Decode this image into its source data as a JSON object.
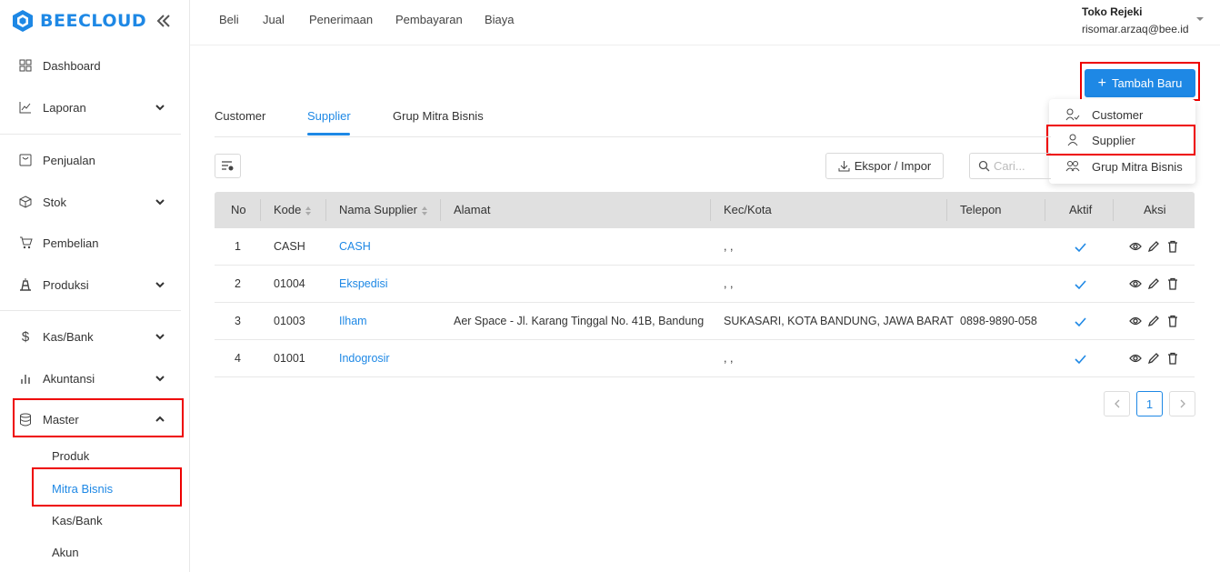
{
  "brand": {
    "name": "BEECLOUD",
    "color": "#1e88e5"
  },
  "sidebar": {
    "items": [
      {
        "label": "Dashboard",
        "icon": "grid-icon",
        "has_chevron": false
      },
      {
        "label": "Laporan",
        "icon": "chart-line-icon",
        "has_chevron": true
      },
      {
        "label": "Penjualan",
        "icon": "bag-icon",
        "has_chevron": false
      },
      {
        "label": "Stok",
        "icon": "box-icon",
        "has_chevron": true
      },
      {
        "label": "Pembelian",
        "icon": "cart-icon",
        "has_chevron": false
      },
      {
        "label": "Produksi",
        "icon": "factory-icon",
        "has_chevron": true
      },
      {
        "label": "Kas/Bank",
        "icon": "dollar-icon",
        "has_chevron": true
      },
      {
        "label": "Akuntansi",
        "icon": "bar-chart-icon",
        "has_chevron": true
      },
      {
        "label": "Master",
        "icon": "database-icon",
        "has_chevron": true,
        "expanded": true
      }
    ],
    "master_sub": [
      {
        "label": "Produk",
        "active": false
      },
      {
        "label": "Mitra Bisnis",
        "active": true
      },
      {
        "label": "Kas/Bank",
        "active": false
      },
      {
        "label": "Akun",
        "active": false
      }
    ]
  },
  "topnav": {
    "links": [
      "Beli",
      "Jual",
      "Penerimaan",
      "Pembayaran",
      "Biaya"
    ],
    "user_name": "Toko Rejeki",
    "user_email": "risomar.arzaq@bee.id"
  },
  "tabs": [
    {
      "label": "Customer",
      "active": false
    },
    {
      "label": "Supplier",
      "active": true
    },
    {
      "label": "Grup Mitra Bisnis",
      "active": false
    }
  ],
  "add_button": {
    "label": "Tambah Baru"
  },
  "add_menu": [
    {
      "label": "Customer",
      "icon": "user-check-icon"
    },
    {
      "label": "Supplier",
      "icon": "user-icon"
    },
    {
      "label": "Grup Mitra Bisnis",
      "icon": "users-icon"
    }
  ],
  "toolbar": {
    "export_label": "Ekspor / Impor",
    "search_placeholder": "Cari..."
  },
  "table": {
    "columns": [
      "No",
      "Kode",
      "Nama Supplier",
      "Alamat",
      "Kec/Kota",
      "Telepon",
      "Aktif",
      "Aksi"
    ],
    "rows": [
      {
        "no": "1",
        "kode": "CASH",
        "nama": "CASH",
        "alamat": "",
        "kota": ", ,",
        "telepon": "",
        "aktif": true
      },
      {
        "no": "2",
        "kode": "01004",
        "nama": "Ekspedisi",
        "alamat": "",
        "kota": ", ,",
        "telepon": "",
        "aktif": true
      },
      {
        "no": "3",
        "kode": "01003",
        "nama": "Ilham",
        "alamat": "Aer Space - Jl. Karang Tinggal No. 41B, Bandung",
        "kota": "SUKASARI, KOTA BANDUNG, JAWA BARAT",
        "telepon": "0898-9890-058",
        "aktif": true
      },
      {
        "no": "4",
        "kode": "01001",
        "nama": "Indogrosir",
        "alamat": "",
        "kota": ", ,",
        "telepon": "",
        "aktif": true
      }
    ]
  },
  "pagination": {
    "current": "1"
  },
  "colors": {
    "accent": "#1e88e5",
    "highlight": "#ee0000",
    "header_bg": "#e0e0e0"
  }
}
